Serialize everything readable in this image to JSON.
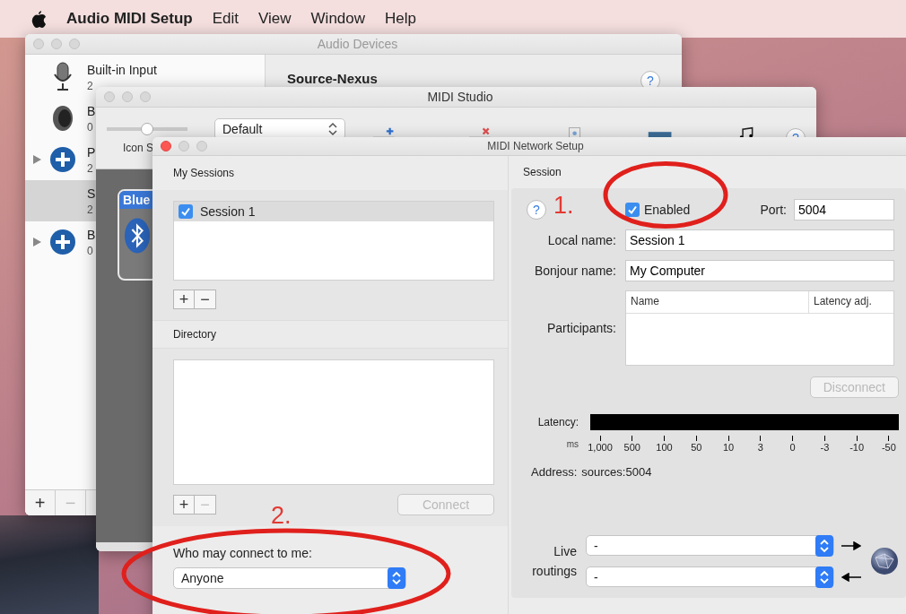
{
  "menu_bar": {
    "app_name": "Audio MIDI Setup",
    "items": [
      "Edit",
      "View",
      "Window",
      "Help"
    ]
  },
  "audio_devices": {
    "title": "Audio Devices",
    "devices": [
      {
        "kind": "microphone",
        "name": "Built-in Input",
        "detail": "2",
        "selected": false,
        "expandable": false
      },
      {
        "kind": "speaker",
        "name": "B",
        "detail": "0",
        "selected": false,
        "expandable": false
      },
      {
        "kind": "aggregate",
        "name": "P",
        "detail": "2",
        "selected": false,
        "expandable": true
      },
      {
        "kind": "plain",
        "name": "S",
        "detail": "2",
        "selected": true,
        "expandable": false
      },
      {
        "kind": "aggregate",
        "name": "B",
        "detail": "0",
        "selected": false,
        "expandable": true
      }
    ],
    "device_heading": "Source-Nexus",
    "help": "?",
    "toolbar": [
      {
        "label": "+",
        "disabled": false
      },
      {
        "label": "−",
        "disabled": true
      }
    ]
  },
  "midi_studio": {
    "title": "MIDI Studio",
    "icon_size": {
      "label": "Icon S",
      "level": 0.5
    },
    "view_popup": "Default",
    "device_card": "Blue",
    "help": "?"
  },
  "network_setup": {
    "title": "MIDI Network Setup",
    "my_sessions": {
      "heading": "My Sessions",
      "sessions": [
        {
          "name": "Session 1",
          "checked": true,
          "selected": true
        }
      ],
      "buttons": [
        {
          "label": "+",
          "disabled": false
        },
        {
          "label": "−",
          "disabled": false
        }
      ]
    },
    "directory": {
      "heading": "Directory",
      "buttons": [
        {
          "label": "+",
          "disabled": false
        },
        {
          "label": "−",
          "disabled": true
        }
      ],
      "connect_button": {
        "label": "Connect",
        "disabled": true
      }
    },
    "who_may_connect": {
      "label": "Who may connect to me:",
      "value": "Anyone"
    },
    "session": {
      "heading": "Session",
      "help": "?",
      "enabled": {
        "label": "Enabled",
        "checked": true
      },
      "port": {
        "label": "Port:",
        "value": "5004"
      },
      "local_name": {
        "label": "Local name:",
        "value": "Session 1"
      },
      "bonjour_name": {
        "label": "Bonjour name:",
        "value": "My Computer"
      },
      "participants": {
        "label": "Participants:",
        "columns": [
          "Name",
          "Latency adj."
        ]
      },
      "disconnect_button": {
        "label": "Disconnect",
        "disabled": true
      },
      "latency": {
        "label": "Latency:",
        "unit": "ms",
        "scale": [
          "1,000",
          "500",
          "100",
          "50",
          "10",
          "3",
          "0",
          "-3",
          "-10",
          "-50"
        ]
      },
      "address": {
        "label": "Address:",
        "value": "sources:5004"
      },
      "live_routings": {
        "label": "Live routings",
        "routes": [
          {
            "value": "-",
            "kind": "outgoing"
          },
          {
            "value": "-",
            "kind": "incoming"
          }
        ]
      }
    }
  },
  "annotations": [
    {
      "label": "1."
    },
    {
      "label": "2."
    }
  ]
}
